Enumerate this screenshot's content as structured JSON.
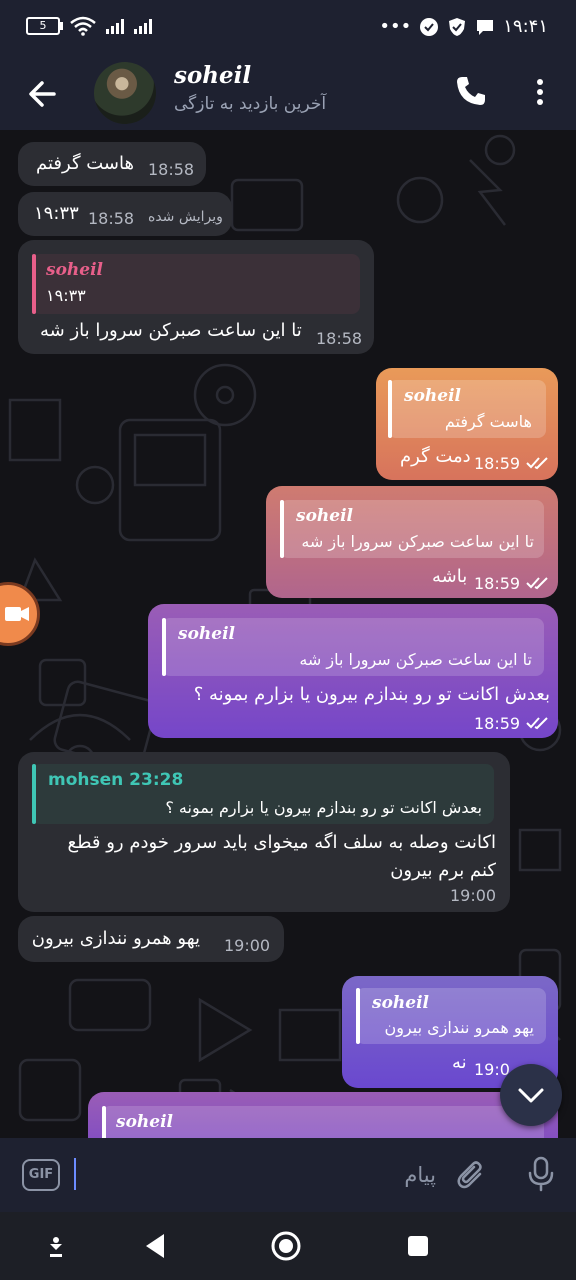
{
  "status_bar": {
    "battery": "5",
    "time": "۱۹:۴۱",
    "more": "•••"
  },
  "header": {
    "contact_name": "soheil",
    "last_seen": "آخرین بازدید به تازگی"
  },
  "messages": [
    {
      "text": "هاست گرفتم",
      "time": "18:58"
    },
    {
      "text": "۱۹:۳۳",
      "edited_label": "ویرایش شده",
      "time": "18:58"
    },
    {
      "reply_name": "soheil",
      "reply_text": "۱۹:۳۳",
      "text": "تا این ساعت صبرکن سرورا باز شه",
      "time": "18:58"
    },
    {
      "reply_name": "soheil",
      "reply_text": "هاست گرفتم",
      "text": "دمت گرم",
      "time": "18:59"
    },
    {
      "reply_name": "soheil",
      "reply_text": "تا این ساعت صبرکن سرورا باز شه",
      "text": "باشه",
      "time": "18:59"
    },
    {
      "reply_name": "soheil",
      "reply_text": "تا این ساعت صبرکن سرورا باز شه",
      "text": "بعدش اکانت تو رو بندازم بیرون یا بزارم بمونه ؟",
      "time": "18:59"
    },
    {
      "reply_name": "mohsen 23:28",
      "reply_text": "بعدش اکانت تو رو بندازم بیرون یا بزارم بمونه ؟",
      "text_line1": "اکانت وصله به سلف اگه میخوای باید سرور خودم رو قطع",
      "text_line2": "کنم برم بیرون",
      "time": "19:00"
    },
    {
      "text": "یهو همرو نندازی بیرون",
      "time": "19:00"
    },
    {
      "reply_name": "soheil",
      "reply_text": "یهو همرو نندازی بیرون",
      "text": "نه",
      "time": "19:0"
    },
    {
      "reply_name": "soheil"
    }
  ],
  "input": {
    "gif_label": "GIF",
    "placeholder": "پیام"
  },
  "colors": {
    "accent_reply_pink": "#e85f8a",
    "accent_reply_teal": "#3fc6b5",
    "bubble_incoming": "#2c2d33",
    "header_bg": "#1e2130"
  }
}
